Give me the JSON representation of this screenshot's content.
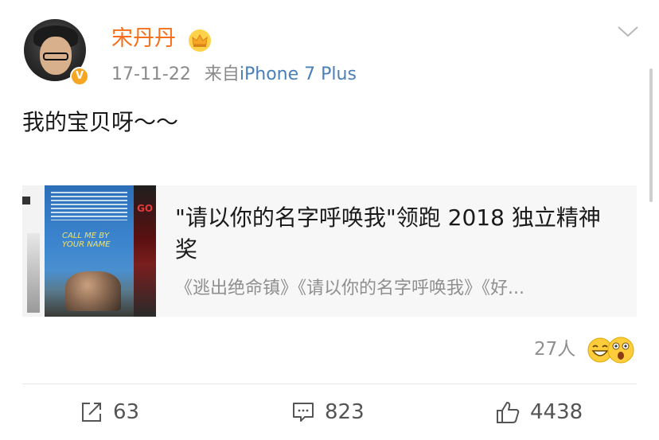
{
  "post": {
    "username": "宋丹丹",
    "timestamp": "17-11-22",
    "source_prefix": "来自",
    "source_device": "iPhone 7 Plus",
    "text": "我的宝贝呀～～",
    "verified_badge": "V"
  },
  "card": {
    "title": "\"请以你的名字呼唤我\"领跑 2018 独立精神奖",
    "description": "《逃出绝命镇》《请以你的名字呼唤我》《好...",
    "poster_title": "CALL ME BY YOUR NAME",
    "right_strip_text": "GO"
  },
  "reactions": {
    "count": "27人",
    "icons": [
      "laugh-emoji",
      "shock-emoji"
    ]
  },
  "actions": {
    "repost": "63",
    "comment": "823",
    "like": "4438"
  },
  "colors": {
    "username": "#f56f1c",
    "source": "#4a7fb7",
    "meta": "#8a8a8a",
    "badge": "#f5a623"
  }
}
